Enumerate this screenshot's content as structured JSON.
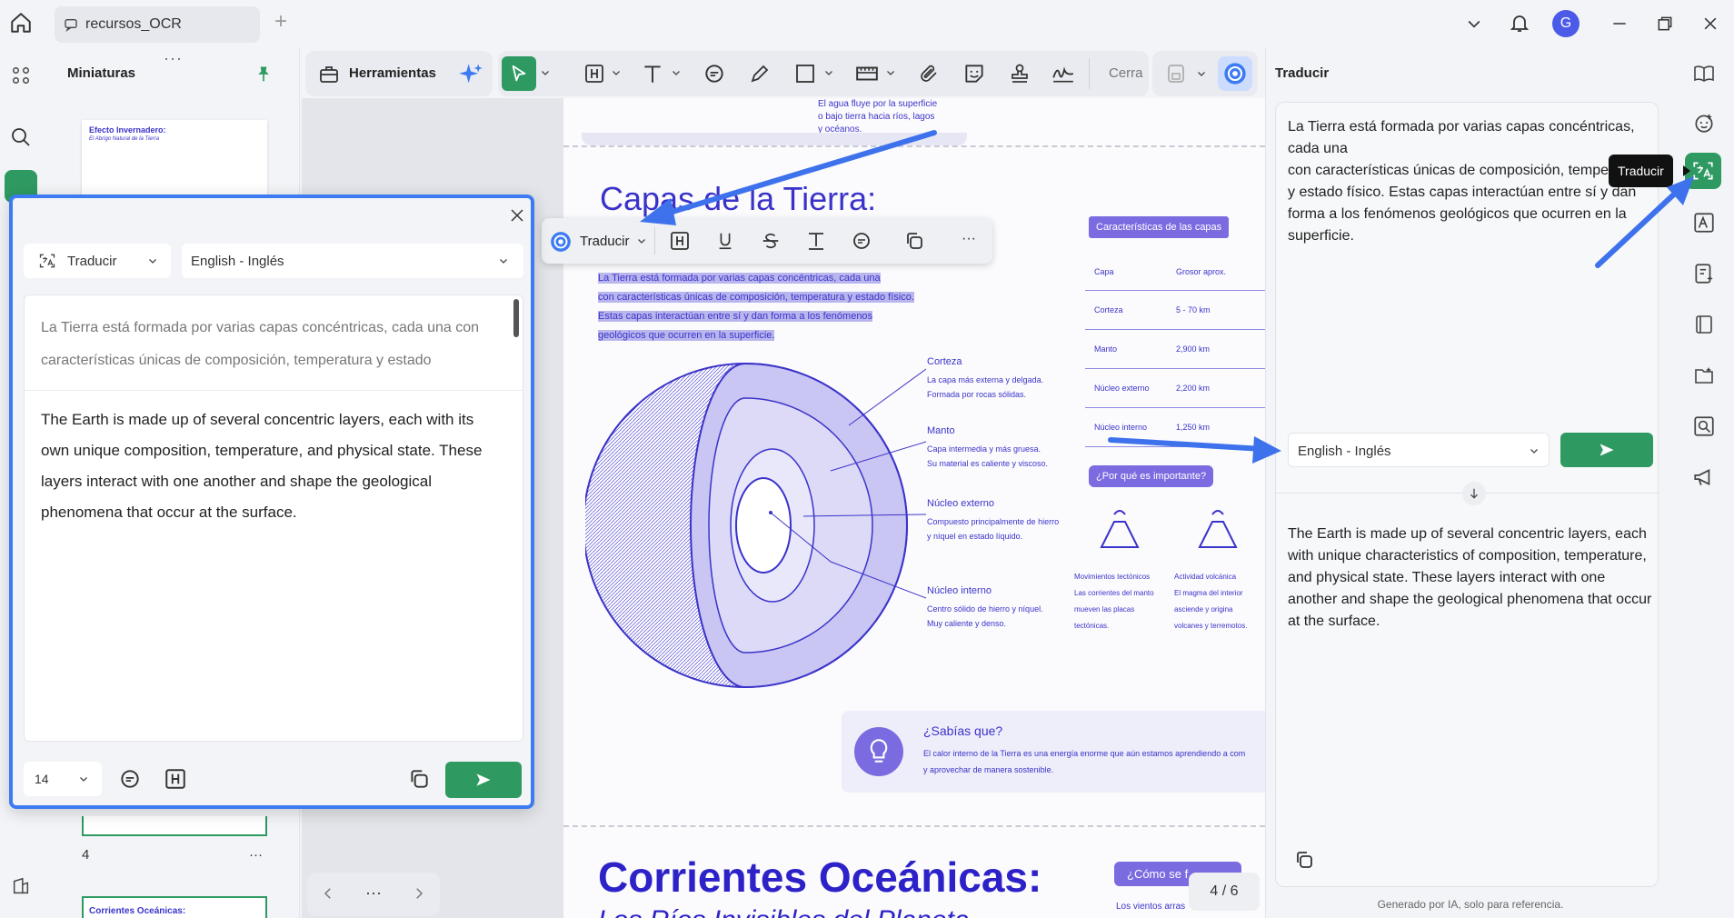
{
  "tab": {
    "title": "recursos_OCR",
    "add": "+"
  },
  "user": {
    "initial": "G"
  },
  "thumbnails": {
    "title": "Miniaturas",
    "thumb1_title": "Efecto Invernadero:",
    "thumb1_subtitle": "El Abrigo Natural de la Tierra",
    "page_number": "4",
    "more": "···",
    "thumb3_title": "Corrientes Oceánicas:"
  },
  "toolbar": {
    "tools_label": "Herramientas",
    "close_label": "Cerra"
  },
  "floating_toolbar": {
    "translate_label": "Traducir",
    "more": "···"
  },
  "document": {
    "top_text": [
      "El agua fluye por la superficie",
      "o bajo tierra hacia ríos, lagos",
      "y océanos."
    ],
    "title": "Capas de la Tierra:",
    "selected_lines": [
      "La Tierra está formada por varias capas concéntricas, cada una",
      "con características únicas de composición, temperatura y estado físico.",
      "Estas capas interactúan entre sí y dan forma a los fenómenos",
      "geológicos que ocurren en la superficie."
    ],
    "layers": [
      {
        "name": "Corteza",
        "desc1": "La capa más externa y delgada.",
        "desc2": "Formada por rocas sólidas."
      },
      {
        "name": "Manto",
        "desc1": "Capa intermedia y más gruesa.",
        "desc2": "Su material es caliente y viscoso."
      },
      {
        "name": "Núcleo externo",
        "desc1": "Compuesto principalmente de hierro",
        "desc2": "y níquel en estado líquido."
      },
      {
        "name": "Núcleo interno",
        "desc1": "Centro sólido de hierro y níquel.",
        "desc2": "Muy caliente y denso."
      }
    ],
    "table": {
      "badge": "Características de las capas",
      "headers": [
        "Capa",
        "Grosor aprox."
      ],
      "rows": [
        [
          "Corteza",
          "5 - 70 km"
        ],
        [
          "Manto",
          "2,900 km"
        ],
        [
          "Núcleo externo",
          "2,200 km"
        ],
        [
          "Núcleo interno",
          "1,250 km"
        ]
      ]
    },
    "why_badge": "¿Por qué es importante?",
    "why_items": [
      {
        "title": "Movimientos tectónicos",
        "l1": "Las corrientes del manto",
        "l2": "mueven las placas",
        "l3": "tectónicas."
      },
      {
        "title": "Actividad volcánica",
        "l1": "El magma del interior",
        "l2": "asciende y origina",
        "l3": "volcanes y terremotos."
      }
    ],
    "did_you_know": {
      "title": "¿Sabías que?",
      "line1": "El calor interno de la Tierra es una energía enorme que aún estamos aprendiendo a com",
      "line2": "y aprovechar de manera sostenible."
    },
    "next_title": "Corrientes Oceánicas:",
    "next_subtitle": "Los Ríos Invisibles del Planeta",
    "next_badge": "¿Cómo se f",
    "next_text": "Los vientos arras",
    "page_indicator": "4 / 6"
  },
  "bottom_nav": {
    "more": "···"
  },
  "dialog": {
    "mode": "Traducir",
    "language": "English - Inglés",
    "source_text": "La Tierra está formada por varias capas concéntricas, cada una con características únicas de composición, temperatura y estado",
    "result_text": "The Earth is made up of several concentric layers, each with its own unique composition, temperature, and physical state. These layers interact with one another and shape the geological phenomena that occur at the surface.",
    "font_size": "14"
  },
  "right_panel": {
    "title": "Traducir",
    "source_text": "La Tierra está formada por varias capas concéntricas, cada una\ncon características únicas de composición, temperatura y estado físico. Estas capas interactúan entre sí y dan forma a los fenómenos geológicos que ocurren en la superficie.",
    "language": "English - Inglés",
    "result_text": "The Earth is made up of several concentric layers, each with unique characteristics of composition, temperature, and physical state. These layers interact with one another and shape the geological phenomena that occur at the surface.",
    "footer": "Generado por IA, solo para referencia."
  },
  "tooltip": {
    "label": "Traducir"
  },
  "colors": {
    "accent": "#3d7bf2",
    "doc_blue": "#3b33c9",
    "green": "#2e9a62",
    "purple": "#7a6be0"
  }
}
